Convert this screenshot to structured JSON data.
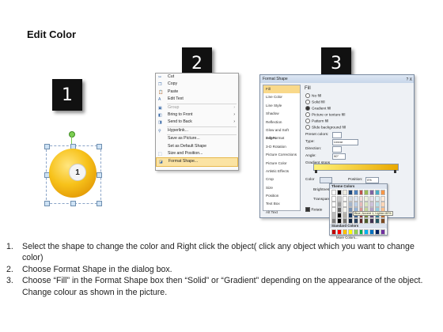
{
  "title": "Edit Color",
  "steps": [
    "1",
    "2",
    "3"
  ],
  "shape": {
    "number": "1"
  },
  "context_menu": {
    "items": [
      {
        "label": "Cut",
        "icon": "scissors-icon",
        "disabled": false,
        "submenu": false
      },
      {
        "label": "Copy",
        "icon": "copy-icon",
        "disabled": false,
        "submenu": false
      },
      {
        "label": "Paste",
        "icon": "paste-icon",
        "disabled": false,
        "submenu": false
      },
      {
        "label": "Edit Text",
        "icon": "edit-text-icon",
        "disabled": false,
        "submenu": false,
        "sep_after": true
      },
      {
        "label": "Group",
        "icon": "group-icon",
        "disabled": true,
        "submenu": true
      },
      {
        "label": "Bring to Front",
        "icon": "bring-front-icon",
        "disabled": false,
        "submenu": true
      },
      {
        "label": "Send to Back",
        "icon": "send-back-icon",
        "disabled": false,
        "submenu": true,
        "sep_after": true
      },
      {
        "label": "Hyperlink...",
        "icon": "hyperlink-icon",
        "disabled": false,
        "submenu": false,
        "sep_after": true
      },
      {
        "label": "Save as Picture...",
        "icon": "",
        "disabled": false,
        "submenu": false
      },
      {
        "label": "Set as Default Shape",
        "icon": "",
        "disabled": false,
        "submenu": false
      },
      {
        "label": "Size and Position...",
        "icon": "size-icon",
        "disabled": false,
        "submenu": false
      },
      {
        "label": "Format Shape...",
        "icon": "format-shape-icon",
        "disabled": false,
        "submenu": false,
        "highlight": true
      }
    ]
  },
  "dialog": {
    "title": "Format Shape",
    "title_buttons": "? X",
    "categories": [
      "Fill",
      "Line Color",
      "Line Style",
      "Shadow",
      "Reflection",
      "Glow and Soft Edges",
      "3-D Format",
      "3-D Rotation",
      "Picture Corrections",
      "Picture Color",
      "Artistic Effects",
      "Crop",
      "Size",
      "Position",
      "Text Box",
      "Alt Text"
    ],
    "pane_header": "Fill",
    "fill_options": [
      "No fill",
      "Solid fill",
      "Gradient fill",
      "Picture or texture fill",
      "Pattern fill",
      "Slide background fill"
    ],
    "fill_selected": 2,
    "preset_colors_label": "Preset colors:",
    "type_label": "Type:",
    "type_value": "Linear",
    "direction_label": "Direction:",
    "angle_label": "Angle:",
    "angle_value": "90°",
    "gradient_stops_label": "Gradient stops",
    "color_label": "Color",
    "position_label": "Position:",
    "position_value": "0%",
    "brightness_label": "Brightness",
    "transparency_label": "Transparency",
    "rotate_label": "Rotate"
  },
  "palette": {
    "theme_label": "Theme Colors",
    "standard_label": "Standard Colors",
    "more_label": "More Colors...",
    "tooltip": "Blue, Accent 1, Lighter 80%",
    "theme_top": [
      "#ffffff",
      "#000000",
      "#eeece1",
      "#1f497d",
      "#4f81bd",
      "#c0504d",
      "#9bbb59",
      "#8064a2",
      "#4bacc6",
      "#f79646"
    ],
    "standard": [
      "#c00000",
      "#ff0000",
      "#ffc000",
      "#ffff00",
      "#92d050",
      "#00b050",
      "#00b0f0",
      "#0070c0",
      "#002060",
      "#7030a0"
    ]
  },
  "instructions": [
    {
      "num": "1.",
      "text": "Select the shape to change the color and Right click the object( click any object which you want to change color)"
    },
    {
      "num": "2.",
      "text": "Choose Format Shape in the dialog box."
    },
    {
      "num": "3.",
      "text": "Choose “Fill” in the Format Shape box then “Solid” or “Gradient” depending on the appearance of the object. Change colour as shown in the picture."
    }
  ]
}
